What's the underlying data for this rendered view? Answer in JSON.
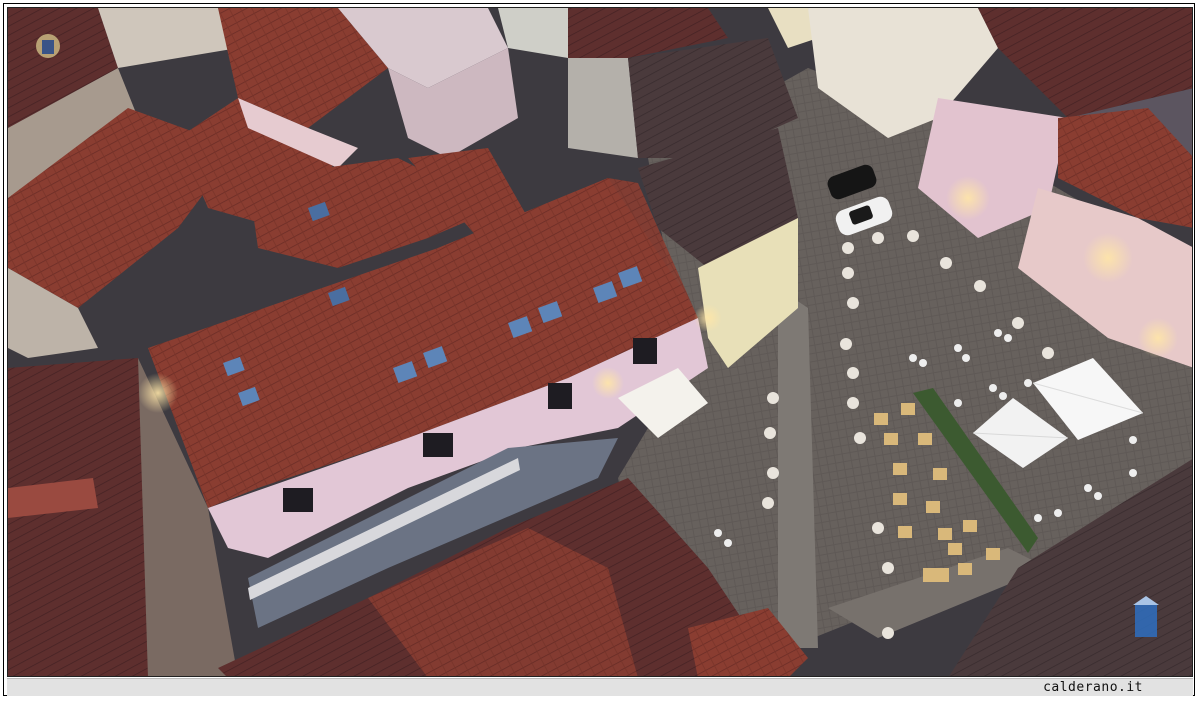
{
  "photo": {
    "subject": "",
    "signature_text": "",
    "emblem_top_left": "crest-icon",
    "emblem_bottom_right": "crest-icon"
  },
  "caption": {
    "text": "calderano.it"
  },
  "colors": {
    "roof": "#8a3b30",
    "roof_dark": "#5a2e2c",
    "pavement": "#5b5654",
    "wall_pink": "#d8b9c4",
    "wall_yellow": "#e8e0b8",
    "umbrella": "#f2f2f2",
    "caption_bar": "#e2e2e2"
  }
}
